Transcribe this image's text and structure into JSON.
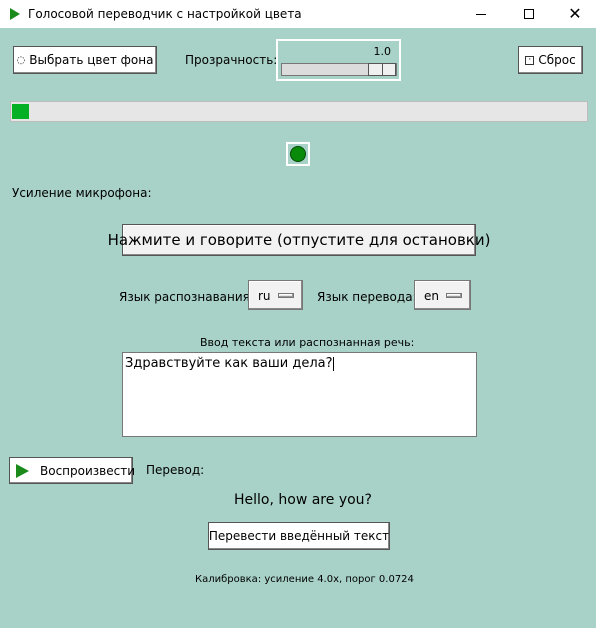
{
  "window": {
    "title": "Голосовой переводчик с настройкой цвета",
    "icon": "play-icon",
    "controls": [
      "minimize-icon",
      "maximize-icon",
      "close-icon"
    ]
  },
  "toolbar": {
    "color_button_label": "Выбрать цвет фона",
    "opacity_label": "Прозрачность:",
    "opacity_value": "1.0",
    "opacity_fraction": 1.0,
    "reset_button_label": "Сброс"
  },
  "audio": {
    "level_fraction": 0.03,
    "indicator_color": "#0a8a0a",
    "gain_label": "Усиление микрофона:"
  },
  "talk_button_label": "Нажмите и говорите (отпустите для остановки)",
  "languages": {
    "recognition_label": "Язык распознавания:",
    "recognition_value": "ru",
    "translation_label": "Язык перевода:",
    "translation_value": "en"
  },
  "input": {
    "label": "Ввод текста или распознанная речь:",
    "value": "Здравствуйте как ваши дела?"
  },
  "output": {
    "play_button_label": "Воспроизвести",
    "translation_label": "Перевод:",
    "translation_text": "Hello, how are you?",
    "translate_button_label": "Перевести введённый текст"
  },
  "status": {
    "calibration": "Калибровка: усиление 4.0x, порог 0.0724"
  },
  "colors": {
    "background": "#a8d2c8",
    "progress_fill": "#06b025",
    "accent_green": "#1a8a1a"
  }
}
